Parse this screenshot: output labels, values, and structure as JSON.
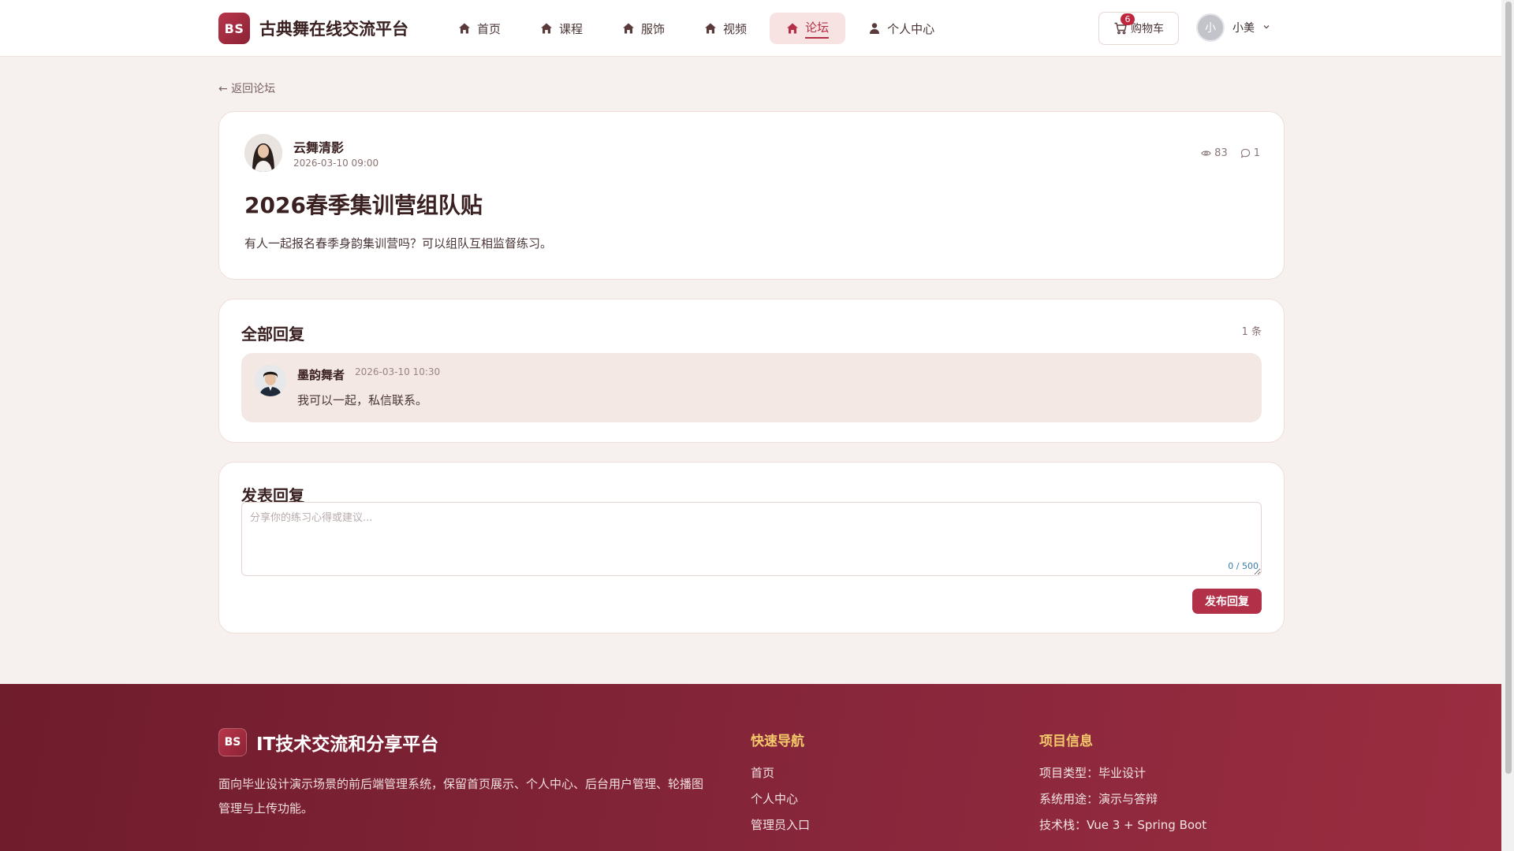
{
  "brand": {
    "logo_text": "BS",
    "name": "古典舞在线交流平台"
  },
  "nav": {
    "items": [
      {
        "label": "首页",
        "icon": "home-icon",
        "active": false
      },
      {
        "label": "课程",
        "icon": "home-icon",
        "active": false
      },
      {
        "label": "服饰",
        "icon": "home-icon",
        "active": false
      },
      {
        "label": "视频",
        "icon": "home-icon",
        "active": false
      },
      {
        "label": "论坛",
        "icon": "home-icon",
        "active": true
      },
      {
        "label": "个人中心",
        "icon": "user-icon",
        "active": false
      }
    ]
  },
  "cart": {
    "label": "购物车",
    "badge": "6"
  },
  "user": {
    "avatar_text": "小",
    "name": "小美"
  },
  "back_link": "← 返回论坛",
  "post": {
    "author": "云舞清影",
    "time": "2026-03-10 09:00",
    "views": "83",
    "comments": "1",
    "title": "2026春季集训营组队贴",
    "content": "有人一起报名春季身韵集训营吗？可以组队互相监督练习。"
  },
  "replies": {
    "heading": "全部回复",
    "count": "1 条",
    "items": [
      {
        "name": "墨韵舞者",
        "time": "2026-03-10 10:30",
        "text": "我可以一起，私信联系。"
      }
    ]
  },
  "compose": {
    "heading": "发表回复",
    "placeholder": "分享你的练习心得或建议...",
    "value": "",
    "counter": "0 / 500",
    "submit_label": "发布回复"
  },
  "footer": {
    "logo_text": "BS",
    "brand_name": "IT技术交流和分享平台",
    "description": "面向毕业设计演示场景的前后端管理系统，保留首页展示、个人中心、后台用户管理、轮播图管理与上传功能。",
    "quick_nav": {
      "title": "快速导航",
      "links": [
        "首页",
        "个人中心",
        "管理员入口"
      ]
    },
    "project_info": {
      "title": "项目信息",
      "lines": [
        "项目类型：毕业设计",
        "系统用途：演示与答辩",
        "技术栈：Vue 3 + Spring Boot"
      ]
    }
  },
  "colors": {
    "accent": "#b23048",
    "footer_bg": "#85253a",
    "footer_title": "#f3c86a",
    "page_bg": "#f6f1ee"
  }
}
